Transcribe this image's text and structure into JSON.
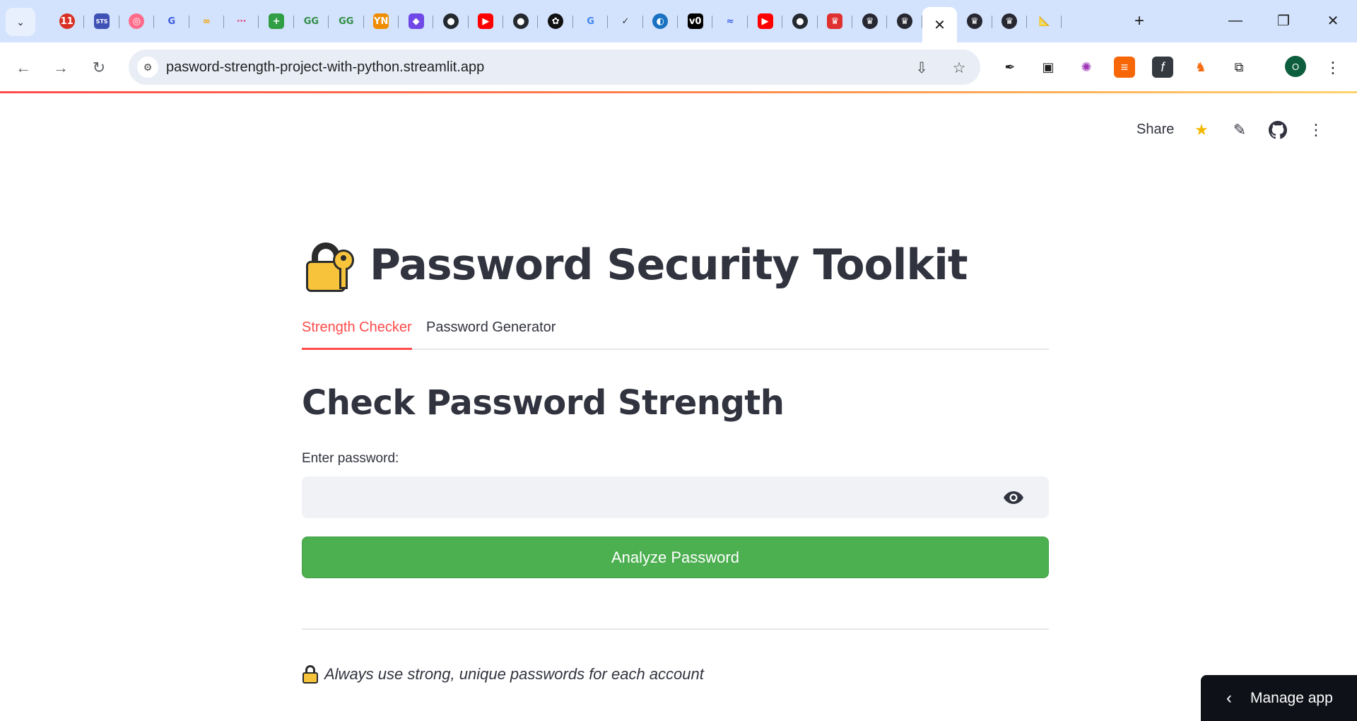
{
  "browser": {
    "tabs": [
      {
        "icon": "calendar-11-icon",
        "glyph": "11",
        "color": "#d93025",
        "round": true
      },
      {
        "icon": "sts-icon",
        "glyph": "STS",
        "color": "#3f51b5"
      },
      {
        "icon": "target-icon",
        "glyph": "◎",
        "color": "#ff6b8a",
        "round": true
      },
      {
        "icon": "g-logo-blue-icon",
        "glyph": "G",
        "color": "#3b5bdb",
        "plain": true
      },
      {
        "icon": "infinity-icon",
        "glyph": "∞",
        "color": "#f59f00",
        "plain": true
      },
      {
        "icon": "nodes-icon",
        "glyph": "⋯",
        "color": "#e64980",
        "plain": true
      },
      {
        "icon": "plus-green-icon",
        "glyph": "+",
        "color": "#2f9e44"
      },
      {
        "icon": "geeksforgeeks-icon",
        "glyph": "GG",
        "color": "#2f8d46",
        "plain": true
      },
      {
        "icon": "geeksforgeeks-icon",
        "glyph": "GG",
        "color": "#2f8d46",
        "plain": true
      },
      {
        "icon": "yn-icon",
        "glyph": "YN",
        "color": "#f08c00"
      },
      {
        "icon": "purple-bird-icon",
        "glyph": "◆",
        "color": "#7048e8"
      },
      {
        "icon": "github-icon",
        "glyph": "●",
        "color": "#24292f",
        "round": true
      },
      {
        "icon": "youtube-icon",
        "glyph": "▶",
        "color": "#ff0000"
      },
      {
        "icon": "github-icon",
        "glyph": "●",
        "color": "#24292f",
        "round": true
      },
      {
        "icon": "openai-icon",
        "glyph": "✿",
        "color": "#111111",
        "round": true
      },
      {
        "icon": "google-icon",
        "glyph": "G",
        "color": "#4285f4",
        "plain": true
      },
      {
        "icon": "check-swoosh-icon",
        "glyph": "✓",
        "color": "#333333",
        "plain": true
      },
      {
        "icon": "blue-circle-icon",
        "glyph": "◐",
        "color": "#1971c2",
        "round": true
      },
      {
        "icon": "v0-icon",
        "glyph": "v0",
        "color": "#000000"
      },
      {
        "icon": "deepseek-whale-icon",
        "glyph": "≈",
        "color": "#4263eb",
        "plain": true
      },
      {
        "icon": "youtube-icon",
        "glyph": "▶",
        "color": "#ff0000"
      },
      {
        "icon": "github-icon",
        "glyph": "●",
        "color": "#24292f",
        "round": true
      },
      {
        "icon": "crown-red-icon",
        "glyph": "♛",
        "color": "#e03131"
      },
      {
        "icon": "streamlit-crown-icon",
        "glyph": "♛",
        "color": "#262730",
        "round": true
      },
      {
        "icon": "streamlit-crown-icon",
        "glyph": "♛",
        "color": "#262730",
        "round": true
      },
      {
        "icon": "close-icon",
        "glyph": "✕",
        "active": true
      },
      {
        "icon": "streamlit-crown-icon",
        "glyph": "♛",
        "color": "#262730",
        "round": true
      },
      {
        "icon": "streamlit-crown-icon",
        "glyph": "♛",
        "color": "#262730",
        "round": true
      },
      {
        "icon": "ruler-triangle-icon",
        "glyph": "📐",
        "color": "#f59f00",
        "plain": true
      }
    ],
    "url": "pasword-strength-project-with-python.streamlit.app",
    "profile_initial": "O"
  },
  "header": {
    "share_label": "Share"
  },
  "main": {
    "title": "Password Security Toolkit",
    "tabs": [
      {
        "label": "Strength Checker",
        "active": true
      },
      {
        "label": "Password Generator",
        "active": false
      }
    ],
    "section_title": "Check Password Strength",
    "password_label": "Enter password:",
    "password_value": "",
    "analyze_label": "Analyze Password",
    "footer_note": "Always use strong, unique passwords for each account"
  },
  "manage_app": {
    "label": "Manage app"
  },
  "colors": {
    "accent": "#ff4b4b",
    "analyze_button": "#4caf50",
    "input_bg": "#f0f2f6",
    "text": "#31333f"
  }
}
